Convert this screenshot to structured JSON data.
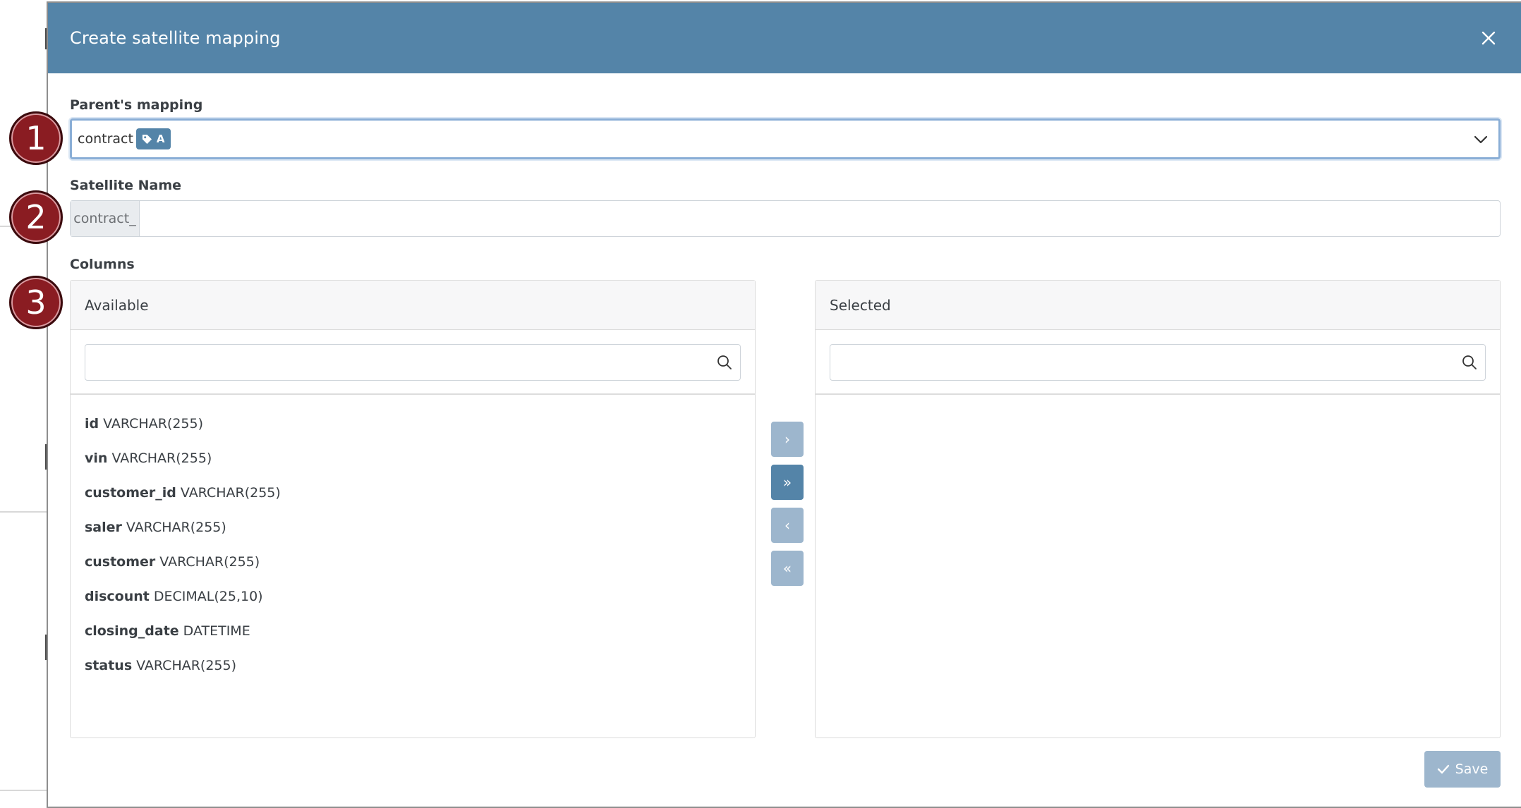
{
  "modal": {
    "title": "Create satellite mapping",
    "accent_color": "#5484a8"
  },
  "parent_mapping": {
    "label": "Parent's mapping",
    "value": "contract",
    "tag_icon": "tag-icon",
    "tag_text": "A"
  },
  "satellite_name": {
    "label": "Satellite Name",
    "prefix": "contract_",
    "value": ""
  },
  "columns": {
    "label": "Columns",
    "available": {
      "title": "Available",
      "search_value": "",
      "items": [
        {
          "name": "id",
          "type": "VARCHAR(255)"
        },
        {
          "name": "vin",
          "type": "VARCHAR(255)"
        },
        {
          "name": "customer_id",
          "type": "VARCHAR(255)"
        },
        {
          "name": "saler",
          "type": "VARCHAR(255)"
        },
        {
          "name": "customer",
          "type": "VARCHAR(255)"
        },
        {
          "name": "discount",
          "type": "DECIMAL(25,10)"
        },
        {
          "name": "closing_date",
          "type": "DATETIME"
        },
        {
          "name": "status",
          "type": "VARCHAR(255)"
        }
      ]
    },
    "selected": {
      "title": "Selected",
      "search_value": "",
      "items": []
    },
    "transfer_buttons": {
      "move_right": "›",
      "move_all_right": "»",
      "move_left": "‹",
      "move_all_left": "«"
    }
  },
  "footer": {
    "save_label": "Save"
  },
  "step_markers": [
    "1",
    "2",
    "3"
  ]
}
